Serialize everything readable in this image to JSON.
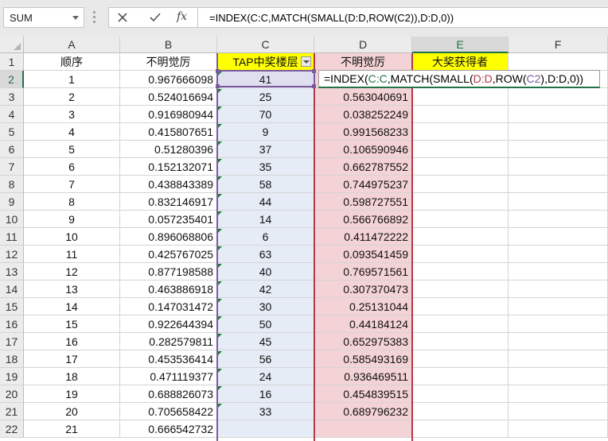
{
  "name_box": {
    "value": "SUM"
  },
  "formula_bar": {
    "cancel_label": "✕",
    "enter_label": "✓",
    "fx_label": "fx",
    "formula": "=INDEX(C:C,MATCH(SMALL(D:D,ROW(C2)),D:D,0))"
  },
  "editing": {
    "prefix": "=INDEX(",
    "ref_cc": "C:C",
    "mid1": ",MATCH(SMALL(",
    "ref_dd": "D:D",
    "mid2": ",ROW(",
    "ref_c2": "C2",
    "mid3": "),",
    "ref_dd2": "D:D",
    "suffix": ",0))"
  },
  "columns": [
    "A",
    "B",
    "C",
    "D",
    "E",
    "F"
  ],
  "row_numbers": [
    "1",
    "2",
    "3",
    "4",
    "5",
    "6",
    "7",
    "8",
    "9",
    "10",
    "11",
    "12",
    "13",
    "14",
    "15",
    "16",
    "17",
    "18",
    "19",
    "20",
    "21",
    "22"
  ],
  "header": {
    "a": "顺序",
    "b": "不明觉厉",
    "c": "TAP中奖楼层",
    "d": "不明觉厉",
    "e": "大奖获得者"
  },
  "rows": [
    {
      "a": "1",
      "b": "0.967666098",
      "c": "41",
      "d": ""
    },
    {
      "a": "2",
      "b": "0.524016694",
      "c": "25",
      "d": "0.563040691"
    },
    {
      "a": "3",
      "b": "0.916980944",
      "c": "70",
      "d": "0.038252249"
    },
    {
      "a": "4",
      "b": "0.415807651",
      "c": "9",
      "d": "0.991568233"
    },
    {
      "a": "5",
      "b": "0.51280396",
      "c": "37",
      "d": "0.106590946"
    },
    {
      "a": "6",
      "b": "0.152132071",
      "c": "35",
      "d": "0.662787552"
    },
    {
      "a": "7",
      "b": "0.438843389",
      "c": "58",
      "d": "0.744975237"
    },
    {
      "a": "8",
      "b": "0.832146917",
      "c": "44",
      "d": "0.598727551"
    },
    {
      "a": "9",
      "b": "0.057235401",
      "c": "14",
      "d": "0.566766892"
    },
    {
      "a": "10",
      "b": "0.896068806",
      "c": "6",
      "d": "0.411472222"
    },
    {
      "a": "11",
      "b": "0.425767025",
      "c": "63",
      "d": "0.093541459"
    },
    {
      "a": "12",
      "b": "0.877198588",
      "c": "40",
      "d": "0.769571561"
    },
    {
      "a": "13",
      "b": "0.463886918",
      "c": "42",
      "d": "0.307370473"
    },
    {
      "a": "14",
      "b": "0.147031472",
      "c": "30",
      "d": "0.25131044"
    },
    {
      "a": "15",
      "b": "0.922644394",
      "c": "50",
      "d": "0.44184124"
    },
    {
      "a": "16",
      "b": "0.282579811",
      "c": "45",
      "d": "0.652975383"
    },
    {
      "a": "17",
      "b": "0.453536414",
      "c": "56",
      "d": "0.585493169"
    },
    {
      "a": "18",
      "b": "0.471119377",
      "c": "24",
      "d": "0.936469511"
    },
    {
      "a": "19",
      "b": "0.688826073",
      "c": "16",
      "d": "0.454839515"
    },
    {
      "a": "20",
      "b": "0.705658422",
      "c": "33",
      "d": "0.689796232"
    },
    {
      "a": "21",
      "b": "0.666542732",
      "c": "",
      "d": ""
    }
  ],
  "colors": {
    "accent_green": "#217346",
    "c_ref": "#7b5aa0",
    "d_ref": "#b03a48",
    "highlight_yellow": "#ffff00"
  }
}
